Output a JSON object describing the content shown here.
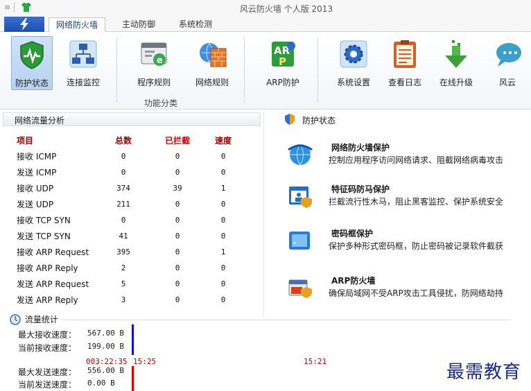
{
  "titlebar": {
    "menu_glyph": "≡",
    "title": "风云防火墙 个人版 2013",
    "icon": "tshirt-icon"
  },
  "tabs": [
    {
      "label": "网络防火墙",
      "active": true
    },
    {
      "label": "主动防御",
      "active": false
    },
    {
      "label": "系统检测",
      "active": false
    }
  ],
  "ribbon": {
    "buttons": [
      {
        "label": "防护状态",
        "icon": "shield-heartbeat-icon"
      },
      {
        "label": "连接监控",
        "icon": "network-computers-icon"
      },
      {
        "label": "程序规则",
        "icon": "program-window-icon"
      },
      {
        "label": "网络规则",
        "icon": "globe-wall-icon"
      },
      {
        "label": "ARP防护",
        "icon": "arp-protect-icon"
      },
      {
        "label": "系统设置",
        "icon": "settings-gear-icon"
      },
      {
        "label": "查看日志",
        "icon": "log-clipboard-icon"
      },
      {
        "label": "在线升级",
        "icon": "download-arrow-icon"
      },
      {
        "label": "风云",
        "icon": "chat-bubble-icon"
      }
    ],
    "group_label": "功能分类"
  },
  "traffic": {
    "title": "网络流量分析",
    "headers": {
      "item": "项目",
      "total": "总数",
      "blocked": "已拦截",
      "speed": "速度"
    },
    "rows": [
      {
        "item": "接收 ICMP",
        "total": "0",
        "blocked": "0",
        "speed": "0"
      },
      {
        "item": "发送 ICMP",
        "total": "0",
        "blocked": "0",
        "speed": "0"
      },
      {
        "item": "接收 UDP",
        "total": "374",
        "blocked": "39",
        "speed": "1"
      },
      {
        "item": "发送 UDP",
        "total": "211",
        "blocked": "0",
        "speed": "0"
      },
      {
        "item": "接收 TCP SYN",
        "total": "0",
        "blocked": "0",
        "speed": "0"
      },
      {
        "item": "发送 TCP SYN",
        "total": "41",
        "blocked": "0",
        "speed": "0"
      },
      {
        "item": "接收 ARP Request",
        "total": "395",
        "blocked": "0",
        "speed": "1"
      },
      {
        "item": "接收 ARP Reply",
        "total": "2",
        "blocked": "0",
        "speed": "0"
      },
      {
        "item": "发送 ARP Request",
        "total": "5",
        "blocked": "0",
        "speed": "0"
      },
      {
        "item": "发送 ARP Reply",
        "total": "3",
        "blocked": "0",
        "speed": "0"
      }
    ]
  },
  "protection": {
    "title": "防护状态",
    "items": [
      {
        "title": "网络防火墙保护",
        "desc": "控制应用程序访问网络请求、阻截网络病毒攻击",
        "icon": "globe-arrows-icon"
      },
      {
        "title": "特征码防马保护",
        "desc": "拦截流行性木马，阻止黑客监控、保护系统安全",
        "icon": "user-shield-window-icon"
      },
      {
        "title": "密码框保护",
        "desc": "保护多种形式密码框，防止密码被记录软件截获",
        "icon": "password-box-icon"
      },
      {
        "title": "ARP防火墙",
        "desc": "确保局域网不受ARP攻击工具侵扰，防网络劫持",
        "icon": "arp-firewall-icon"
      }
    ]
  },
  "stats": {
    "title": "流量统计",
    "max_recv_label": "最大接收速度：",
    "max_recv": "567.00 B",
    "cur_recv_label": "当前接收速度：",
    "cur_recv": "199.00 B",
    "max_send_label": "最大发送速度：",
    "max_send": "556.00 B",
    "cur_send_label": "当前发送速度：",
    "cur_send": "0.00 B",
    "time_elapsed": "003:22:35",
    "time_start": "15:25",
    "time_end": "15:21"
  },
  "watermark": "最需教育",
  "colors": {
    "accent": "#1f4fb0",
    "header_red": "#a00000",
    "recv_bar": "#1010d0",
    "send_bar": "#e00000"
  }
}
